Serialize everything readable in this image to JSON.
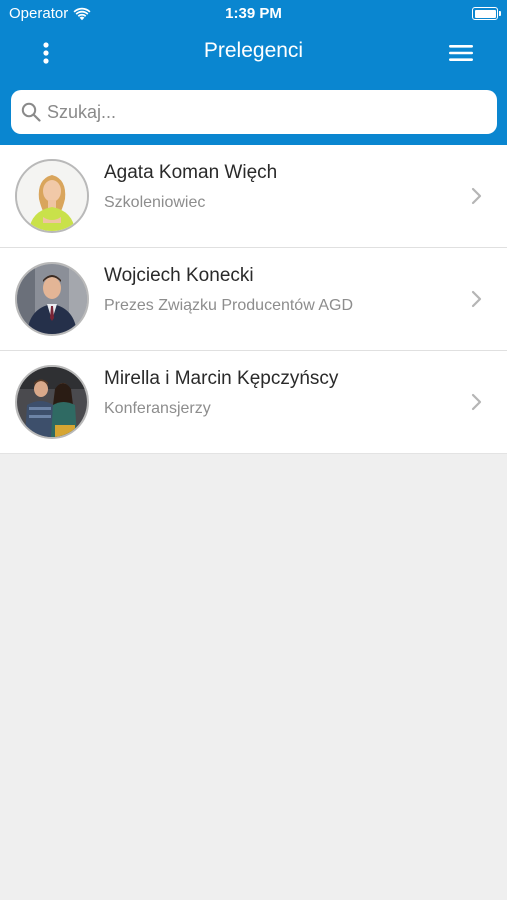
{
  "status_bar": {
    "carrier": "Operator",
    "time": "1:39 PM",
    "wifi_icon": "wifi-icon",
    "battery_icon": "battery-icon"
  },
  "nav": {
    "title": "Prelegenci",
    "left_icon": "more-vertical-icon",
    "right_icon": "hamburger-menu-icon"
  },
  "search": {
    "placeholder": "Szukaj...",
    "value": "",
    "icon": "search-icon"
  },
  "speakers": [
    {
      "name": "Agata Koman Więch",
      "role": "Szkoleniowiec"
    },
    {
      "name": "Wojciech Konecki",
      "role": "Prezes Związku Producentów AGD"
    },
    {
      "name": "Mirella i Marcin Kępczyńscy",
      "role": "Konferansjerzy"
    }
  ],
  "colors": {
    "header": "#0a86d0",
    "background": "#efefef"
  }
}
